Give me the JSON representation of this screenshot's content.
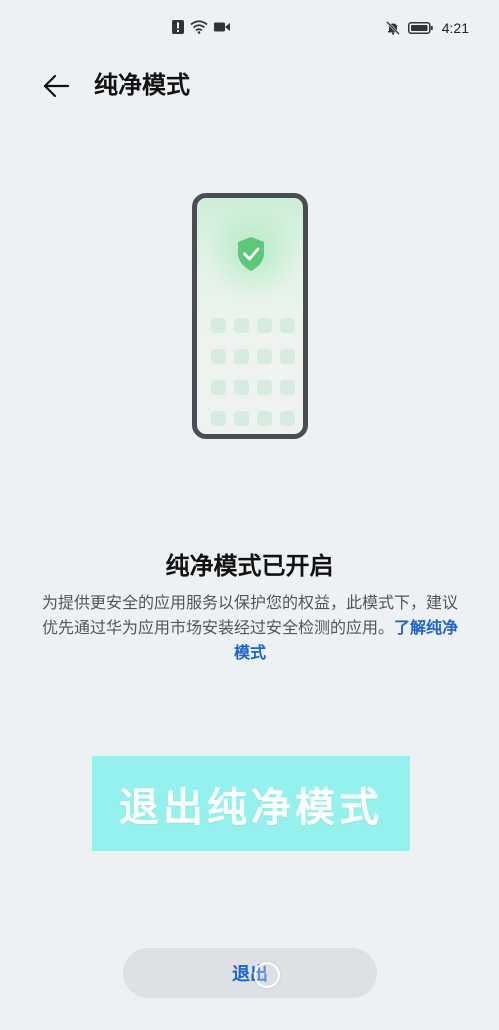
{
  "status_bar": {
    "time": "4:21",
    "icons": [
      "alert-icon",
      "wifi-icon",
      "video-icon",
      "mute-icon",
      "battery-icon"
    ]
  },
  "header": {
    "back_icon": "back-arrow-icon",
    "title": "纯净模式"
  },
  "illustration": {
    "icon": "shield-check-icon",
    "accent": "#5dc77a"
  },
  "content": {
    "headline": "纯净模式已开启",
    "description": "为提供更安全的应用服务以保护您的权益，此模式下，建议优先通过华为应用市场安装经过安全检测的应用。",
    "learn_more": "了解纯净模式"
  },
  "banner": {
    "label": "退出纯净模式",
    "color": "#95f1ee"
  },
  "actions": {
    "exit_label": "退出",
    "accent": "#1e63c8"
  }
}
